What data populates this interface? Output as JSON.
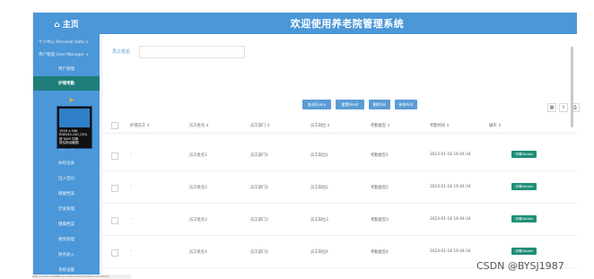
{
  "header": {
    "home_label": "⌂ 主页",
    "title": "欢迎使用养老院管理系统"
  },
  "sidebar": {
    "items": [
      {
        "label": "个人中心 Personal Data ∨"
      },
      {
        "label": "用户管理 User Manager ∨"
      },
      {
        "label": "用户管理"
      },
      {
        "label": "护理考勤"
      },
      {
        "label": "服务项目"
      },
      {
        "label": "服务详情"
      },
      {
        "label": "体检记录"
      },
      {
        "label": "出入登记"
      },
      {
        "label": "健康档案"
      },
      {
        "label": "饮食管理"
      },
      {
        "label": "健康档案"
      },
      {
        "label": "物资管理"
      },
      {
        "label": "财务收入"
      },
      {
        "label": "系统设置"
      }
    ],
    "tooltip_lines": [
      "1920 x 946",
      "RGB(33,130,135)",
      "按 Shift 切换",
      "按住拖动截图"
    ]
  },
  "search": {
    "label": "员工姓名",
    "placeholder": ""
  },
  "actions": {
    "query": "查询Query",
    "reset": "重置Reset",
    "delete": "删除Del",
    "add": "新增Add"
  },
  "table": {
    "columns": [
      "护理员工 ⇕",
      "员工姓名 ⇕",
      "员工部门 ⇕",
      "员工岗位 ⇕",
      "考勤类型 ⇕",
      "考勤时间 ⇕",
      "操作 ⇕"
    ],
    "rows": [
      {
        "staff": "-",
        "name": "员工姓名1",
        "dept": "员工部门1",
        "post": "员工岗位1",
        "type": "考勤类型1",
        "time": "2023-01-18 16:44:34",
        "op": "详情Details"
      },
      {
        "staff": "-",
        "name": "员工姓名2",
        "dept": "员工部门2",
        "post": "员工岗位2",
        "type": "考勤类型2",
        "time": "2023-01-18 16:44:34",
        "op": "详情Details"
      },
      {
        "staff": "-",
        "name": "员工姓名3",
        "dept": "员工部门3",
        "post": "员工岗位3",
        "type": "考勤类型3",
        "time": "2023-01-18 16:44:34",
        "op": "详情Details"
      },
      {
        "staff": "-",
        "name": "员工姓名4",
        "dept": "员工部门4",
        "post": "员工岗位4",
        "type": "考勤类型4",
        "time": "2023-01-18 16:44:34",
        "op": "详情Details"
      }
    ]
  },
  "watermark": "CSDN @BYSJ1987",
  "status_text": "http://localhost:8080/springboot/admin/dist/index.html#/"
}
